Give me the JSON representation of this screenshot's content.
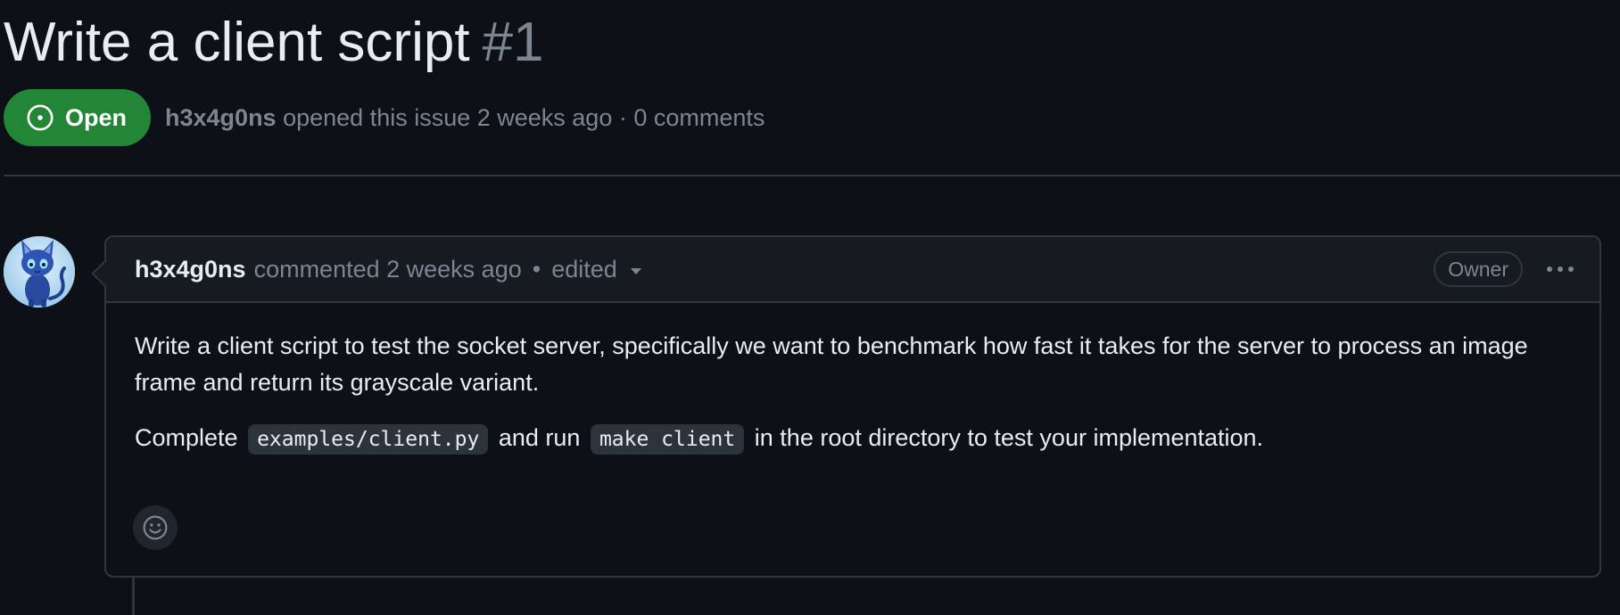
{
  "issue": {
    "title": "Write a client script",
    "number": "#1",
    "state": "Open",
    "author": "h3x4g0ns",
    "opened_text": "opened this issue 2 weeks ago · 0 comments"
  },
  "comment": {
    "author": "h3x4g0ns",
    "timestamp": "commented 2 weeks ago",
    "separator": "•",
    "edited_label": "edited",
    "role_badge": "Owner",
    "body": {
      "paragraph1": "Write a client script to test the socket server, specifically we want to benchmark how fast it takes for the server to process an image frame and return its grayscale variant.",
      "p2_prefix": "Complete",
      "p2_code1": "examples/client.py",
      "p2_middle": "and run",
      "p2_code2": "make client",
      "p2_suffix": "in the root directory to test your implementation."
    }
  },
  "colors": {
    "background": "#0d1117",
    "open_badge": "#238636",
    "muted_text": "#7d8590",
    "border": "#30363d"
  },
  "icons": {
    "state": "issue-opened-icon",
    "caret": "triangle-down-icon",
    "menu": "kebab-horizontal-icon",
    "reaction": "smiley-icon"
  }
}
